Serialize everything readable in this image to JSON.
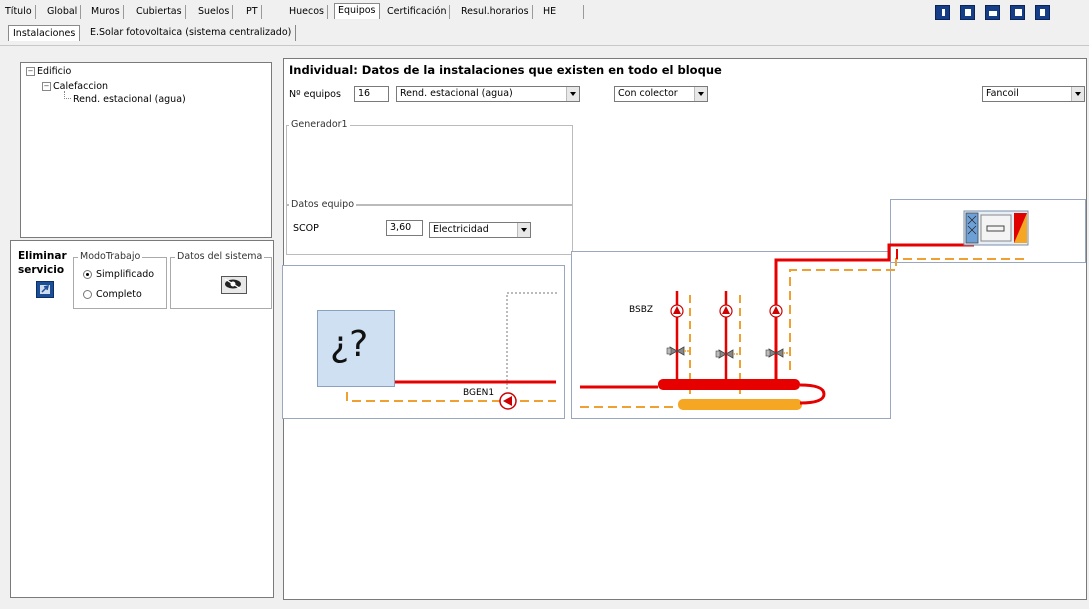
{
  "top_tabs": [
    "Título",
    "Global",
    "Muros",
    "Cubiertas",
    "Suelos",
    "PT",
    "Huecos",
    "Equipos",
    "Certificación",
    "Resul.horarios",
    "HE"
  ],
  "active_top_tab": "Equipos",
  "toolbar_icons": [
    "info-icon",
    "document-icon",
    "folder-icon",
    "save-icon",
    "export-icon"
  ],
  "sub_tabs": [
    "Instalaciones",
    "E.Solar fotovoltaica (sistema centralizado)"
  ],
  "tree": {
    "root": "Edificio",
    "child": "Calefaccion",
    "leaf": "Rend. estacional (agua)"
  },
  "left_panel": {
    "eliminar_line1": "Eliminar",
    "eliminar_line2": "servicio",
    "modo_title": "ModoTrabajo",
    "modo_options": [
      "Simplificado",
      "Completo"
    ],
    "modo_selected": "Simplificado",
    "datos_sistema_title": "Datos del sistema"
  },
  "main": {
    "title": "Individual: Datos de la instalaciones que existen en todo el bloque",
    "n_equipos_label": "Nº equipos",
    "n_equipos_value": "16",
    "type_select": "Rend. estacional (agua)",
    "colector_select": "Con colector",
    "terminal_select": "Fancoil",
    "generador_title": "Generador1",
    "datos_equipo_title": "Datos equipo",
    "scop_label": "SCOP",
    "scop_value": "3,60",
    "energy_select": "Electricidad"
  },
  "diagram": {
    "unknown_generator": "¿?",
    "pump_gen_label": "BGEN1",
    "pump_dist_label": "BSBZ"
  },
  "colors": {
    "supply": "#e60000",
    "return": "#f5a623",
    "tab_active": "#ffffff",
    "toolbar_icon_bg": "#163d88"
  }
}
